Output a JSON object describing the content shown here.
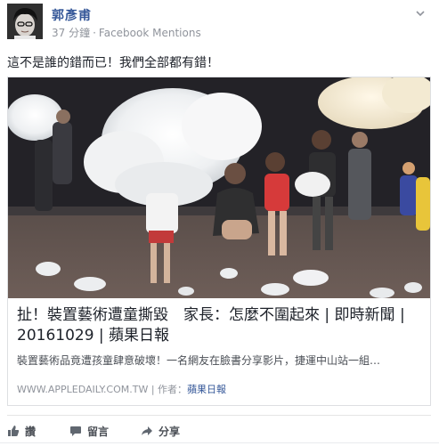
{
  "post": {
    "author": "郭彥甫",
    "time": "37 分鐘",
    "separator": "·",
    "via": "Facebook Mentions",
    "text": "這不是誰的錯而已！我們全部都有錯！"
  },
  "link": {
    "title": "扯！裝置藝術遭童撕毀　家長：怎麼不圍起來 | 即時新聞 | 20161029 | 蘋果日報",
    "description": "裝置藝術品竟遭孩童肆意破壞！一名網友在臉書分享影片，捷運中山站一組…",
    "domain": "WWW.APPLEDAILY.COM.TW",
    "author_prefix": "| 作者：",
    "author": "蘋果日報"
  },
  "actions": {
    "like": "讚",
    "comment": "留言",
    "share": "分享"
  },
  "icons": {
    "avatar": "avatar",
    "menu": "chevron-down-icon",
    "like": "thumbs-up-icon",
    "comment": "comment-icon",
    "share": "share-icon"
  },
  "colors": {
    "link_blue": "#365899",
    "meta_gray": "#90949c",
    "action_gray": "#4b4f56"
  }
}
